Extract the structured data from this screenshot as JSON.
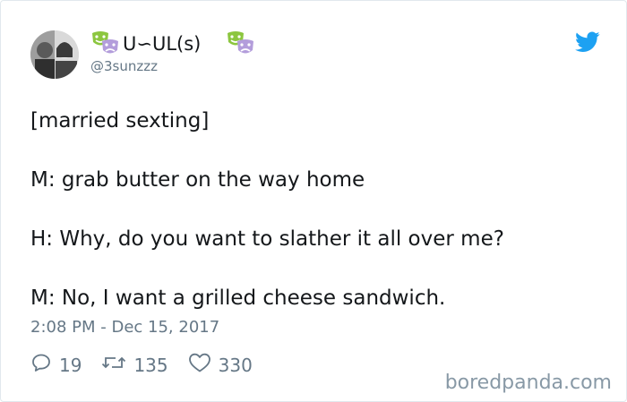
{
  "user": {
    "display_name": "U∽UL(s)",
    "handle": "@3sunzzz"
  },
  "tweet": {
    "lines": [
      "[married sexting]",
      "M: grab butter on the way home",
      "H: Why, do you want to slather it all over me?",
      "M: No, I want a grilled cheese sandwich."
    ],
    "timestamp": "2:08 PM - Dec 15, 2017"
  },
  "stats": {
    "replies": "19",
    "retweets": "135",
    "likes": "330"
  },
  "watermark": "boredpanda.com",
  "icons": {
    "reply": "reply-icon",
    "retweet": "retweet-icon",
    "like": "heart-icon",
    "brand": "twitter-bird-icon",
    "emoji": "performing-arts-icon"
  },
  "colors": {
    "twitter_blue": "#1da1f2",
    "muted_text": "#657786",
    "mask_green": "#8cc63f",
    "mask_purple": "#b39ddb"
  }
}
